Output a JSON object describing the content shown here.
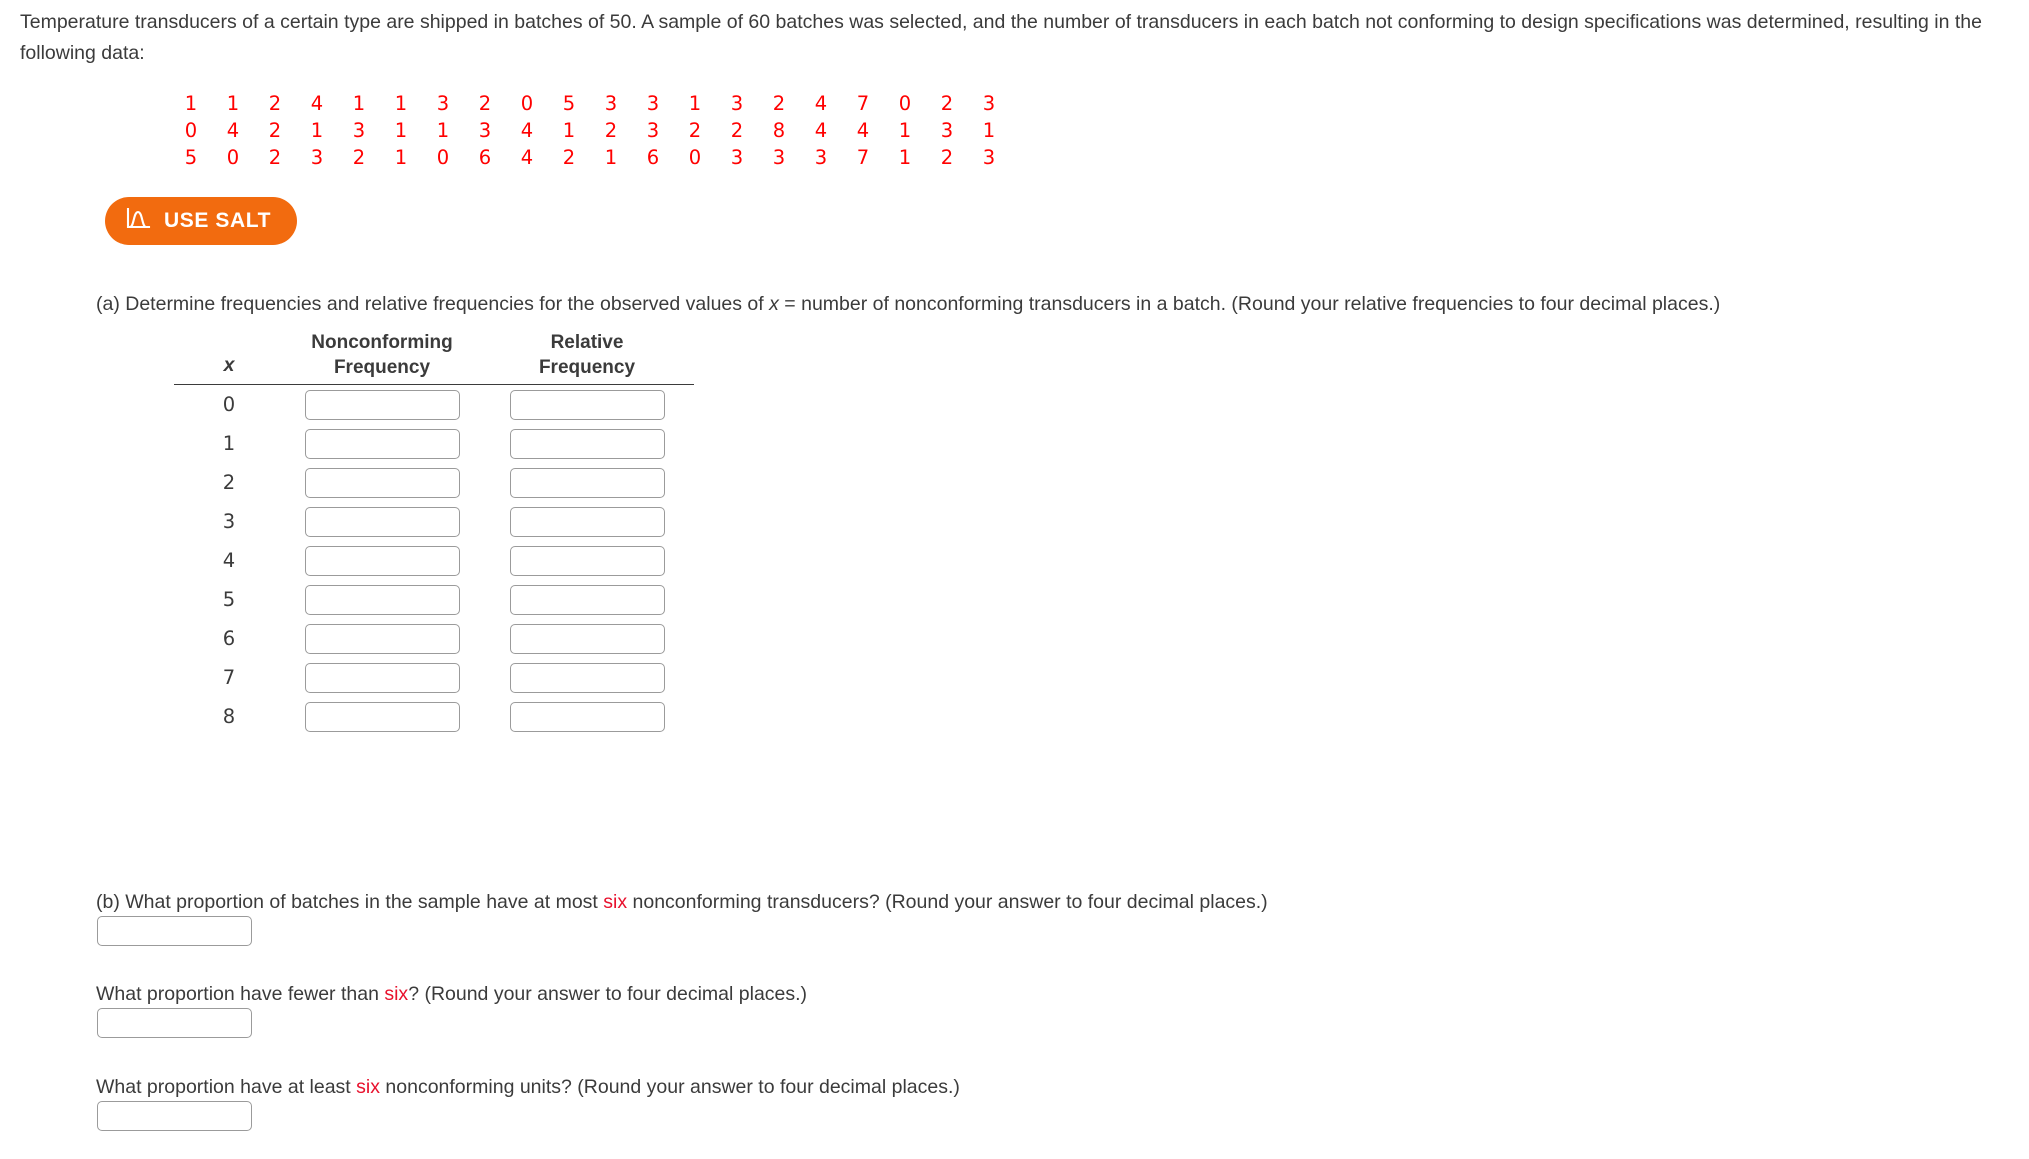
{
  "problem": {
    "intro": "Temperature transducers of a certain type are shipped in batches of 50. A sample of 60 batches was selected, and the number of transducers in each batch not conforming to design specifications was determined, resulting in the following data:",
    "data_color": "#ff0000",
    "data_rows": [
      [
        1,
        1,
        2,
        4,
        1,
        1,
        3,
        2,
        0,
        5,
        3,
        3,
        1,
        3,
        2,
        4,
        7,
        0,
        2,
        3
      ],
      [
        0,
        4,
        2,
        1,
        3,
        1,
        1,
        3,
        4,
        1,
        2,
        3,
        2,
        2,
        8,
        4,
        4,
        1,
        3,
        1
      ],
      [
        5,
        0,
        2,
        3,
        2,
        1,
        0,
        6,
        4,
        2,
        1,
        6,
        0,
        3,
        3,
        3,
        7,
        1,
        2,
        3
      ]
    ]
  },
  "salt_button": {
    "label": "USE SALT",
    "icon": "normal-curve-icon",
    "background": "#f26b0f",
    "text_color": "#ffffff"
  },
  "part_a": {
    "prefix": "(a) Determine frequencies and relative frequencies for the observed values of ",
    "variable": "x",
    "suffix": " = number of nonconforming transducers in a batch. (Round your relative frequencies to four decimal places.)",
    "table": {
      "headers": {
        "x": "x",
        "nonconforming": [
          "Nonconforming",
          "Frequency"
        ],
        "relative": [
          "Relative",
          "Frequency"
        ]
      },
      "rows": [
        {
          "x": "0",
          "nonconforming_value": "",
          "relative_value": ""
        },
        {
          "x": "1",
          "nonconforming_value": "",
          "relative_value": ""
        },
        {
          "x": "2",
          "nonconforming_value": "",
          "relative_value": ""
        },
        {
          "x": "3",
          "nonconforming_value": "",
          "relative_value": ""
        },
        {
          "x": "4",
          "nonconforming_value": "",
          "relative_value": ""
        },
        {
          "x": "5",
          "nonconforming_value": "",
          "relative_value": ""
        },
        {
          "x": "6",
          "nonconforming_value": "",
          "relative_value": ""
        },
        {
          "x": "7",
          "nonconforming_value": "",
          "relative_value": ""
        },
        {
          "x": "8",
          "nonconforming_value": "",
          "relative_value": ""
        }
      ]
    }
  },
  "part_b": {
    "q1": {
      "pre": "(b) What proportion of batches in the sample have at most ",
      "highlight": "six",
      "post": " nonconforming transducers? (Round your answer to four decimal places.)",
      "answer_value": ""
    },
    "q2": {
      "pre": "What proportion have fewer than ",
      "highlight": "six",
      "post": "? (Round your answer to four decimal places.)",
      "answer_value": ""
    },
    "q3": {
      "pre": "What proportion have at least ",
      "highlight": "six",
      "post": " nonconforming units? (Round your answer to four decimal places.)",
      "answer_value": ""
    },
    "highlight_color": "#e8112d"
  }
}
